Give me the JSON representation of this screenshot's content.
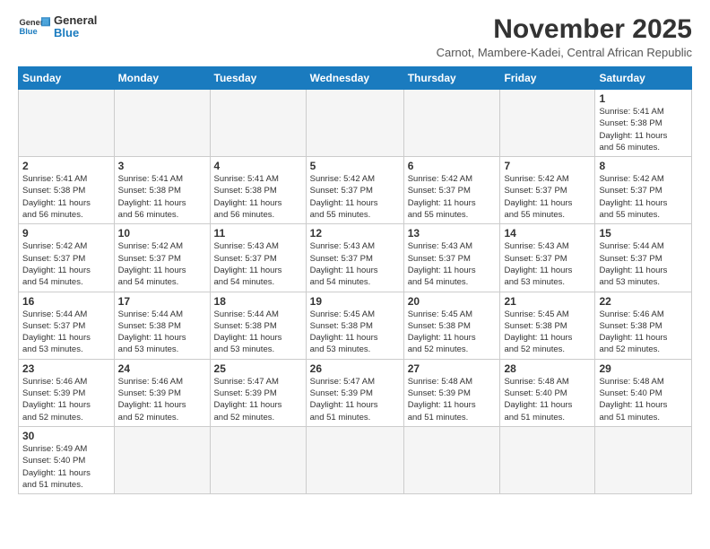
{
  "logo": {
    "line1": "General",
    "line2": "Blue"
  },
  "title": "November 2025",
  "subtitle": "Carnot, Mambere-Kadei, Central African Republic",
  "weekdays": [
    "Sunday",
    "Monday",
    "Tuesday",
    "Wednesday",
    "Thursday",
    "Friday",
    "Saturday"
  ],
  "weeks": [
    [
      {
        "day": "",
        "empty": true
      },
      {
        "day": "",
        "empty": true
      },
      {
        "day": "",
        "empty": true
      },
      {
        "day": "",
        "empty": true
      },
      {
        "day": "",
        "empty": true
      },
      {
        "day": "",
        "empty": true
      },
      {
        "day": "1",
        "sunrise": "5:41 AM",
        "sunset": "5:38 PM",
        "daylight": "11 hours and 56 minutes."
      }
    ],
    [
      {
        "day": "2",
        "sunrise": "5:41 AM",
        "sunset": "5:38 PM",
        "daylight": "11 hours and 56 minutes."
      },
      {
        "day": "3",
        "sunrise": "5:41 AM",
        "sunset": "5:38 PM",
        "daylight": "11 hours and 56 minutes."
      },
      {
        "day": "4",
        "sunrise": "5:41 AM",
        "sunset": "5:38 PM",
        "daylight": "11 hours and 56 minutes."
      },
      {
        "day": "5",
        "sunrise": "5:42 AM",
        "sunset": "5:37 PM",
        "daylight": "11 hours and 55 minutes."
      },
      {
        "day": "6",
        "sunrise": "5:42 AM",
        "sunset": "5:37 PM",
        "daylight": "11 hours and 55 minutes."
      },
      {
        "day": "7",
        "sunrise": "5:42 AM",
        "sunset": "5:37 PM",
        "daylight": "11 hours and 55 minutes."
      },
      {
        "day": "8",
        "sunrise": "5:42 AM",
        "sunset": "5:37 PM",
        "daylight": "11 hours and 55 minutes."
      }
    ],
    [
      {
        "day": "9",
        "sunrise": "5:42 AM",
        "sunset": "5:37 PM",
        "daylight": "11 hours and 54 minutes."
      },
      {
        "day": "10",
        "sunrise": "5:42 AM",
        "sunset": "5:37 PM",
        "daylight": "11 hours and 54 minutes."
      },
      {
        "day": "11",
        "sunrise": "5:43 AM",
        "sunset": "5:37 PM",
        "daylight": "11 hours and 54 minutes."
      },
      {
        "day": "12",
        "sunrise": "5:43 AM",
        "sunset": "5:37 PM",
        "daylight": "11 hours and 54 minutes."
      },
      {
        "day": "13",
        "sunrise": "5:43 AM",
        "sunset": "5:37 PM",
        "daylight": "11 hours and 54 minutes."
      },
      {
        "day": "14",
        "sunrise": "5:43 AM",
        "sunset": "5:37 PM",
        "daylight": "11 hours and 53 minutes."
      },
      {
        "day": "15",
        "sunrise": "5:44 AM",
        "sunset": "5:37 PM",
        "daylight": "11 hours and 53 minutes."
      }
    ],
    [
      {
        "day": "16",
        "sunrise": "5:44 AM",
        "sunset": "5:37 PM",
        "daylight": "11 hours and 53 minutes."
      },
      {
        "day": "17",
        "sunrise": "5:44 AM",
        "sunset": "5:38 PM",
        "daylight": "11 hours and 53 minutes."
      },
      {
        "day": "18",
        "sunrise": "5:44 AM",
        "sunset": "5:38 PM",
        "daylight": "11 hours and 53 minutes."
      },
      {
        "day": "19",
        "sunrise": "5:45 AM",
        "sunset": "5:38 PM",
        "daylight": "11 hours and 53 minutes."
      },
      {
        "day": "20",
        "sunrise": "5:45 AM",
        "sunset": "5:38 PM",
        "daylight": "11 hours and 52 minutes."
      },
      {
        "day": "21",
        "sunrise": "5:45 AM",
        "sunset": "5:38 PM",
        "daylight": "11 hours and 52 minutes."
      },
      {
        "day": "22",
        "sunrise": "5:46 AM",
        "sunset": "5:38 PM",
        "daylight": "11 hours and 52 minutes."
      }
    ],
    [
      {
        "day": "23",
        "sunrise": "5:46 AM",
        "sunset": "5:39 PM",
        "daylight": "11 hours and 52 minutes."
      },
      {
        "day": "24",
        "sunrise": "5:46 AM",
        "sunset": "5:39 PM",
        "daylight": "11 hours and 52 minutes."
      },
      {
        "day": "25",
        "sunrise": "5:47 AM",
        "sunset": "5:39 PM",
        "daylight": "11 hours and 52 minutes."
      },
      {
        "day": "26",
        "sunrise": "5:47 AM",
        "sunset": "5:39 PM",
        "daylight": "11 hours and 51 minutes."
      },
      {
        "day": "27",
        "sunrise": "5:48 AM",
        "sunset": "5:39 PM",
        "daylight": "11 hours and 51 minutes."
      },
      {
        "day": "28",
        "sunrise": "5:48 AM",
        "sunset": "5:40 PM",
        "daylight": "11 hours and 51 minutes."
      },
      {
        "day": "29",
        "sunrise": "5:48 AM",
        "sunset": "5:40 PM",
        "daylight": "11 hours and 51 minutes."
      }
    ],
    [
      {
        "day": "30",
        "sunrise": "5:49 AM",
        "sunset": "5:40 PM",
        "daylight": "11 hours and 51 minutes."
      },
      {
        "day": "",
        "empty": true
      },
      {
        "day": "",
        "empty": true
      },
      {
        "day": "",
        "empty": true
      },
      {
        "day": "",
        "empty": true
      },
      {
        "day": "",
        "empty": true
      },
      {
        "day": "",
        "empty": true
      }
    ]
  ]
}
